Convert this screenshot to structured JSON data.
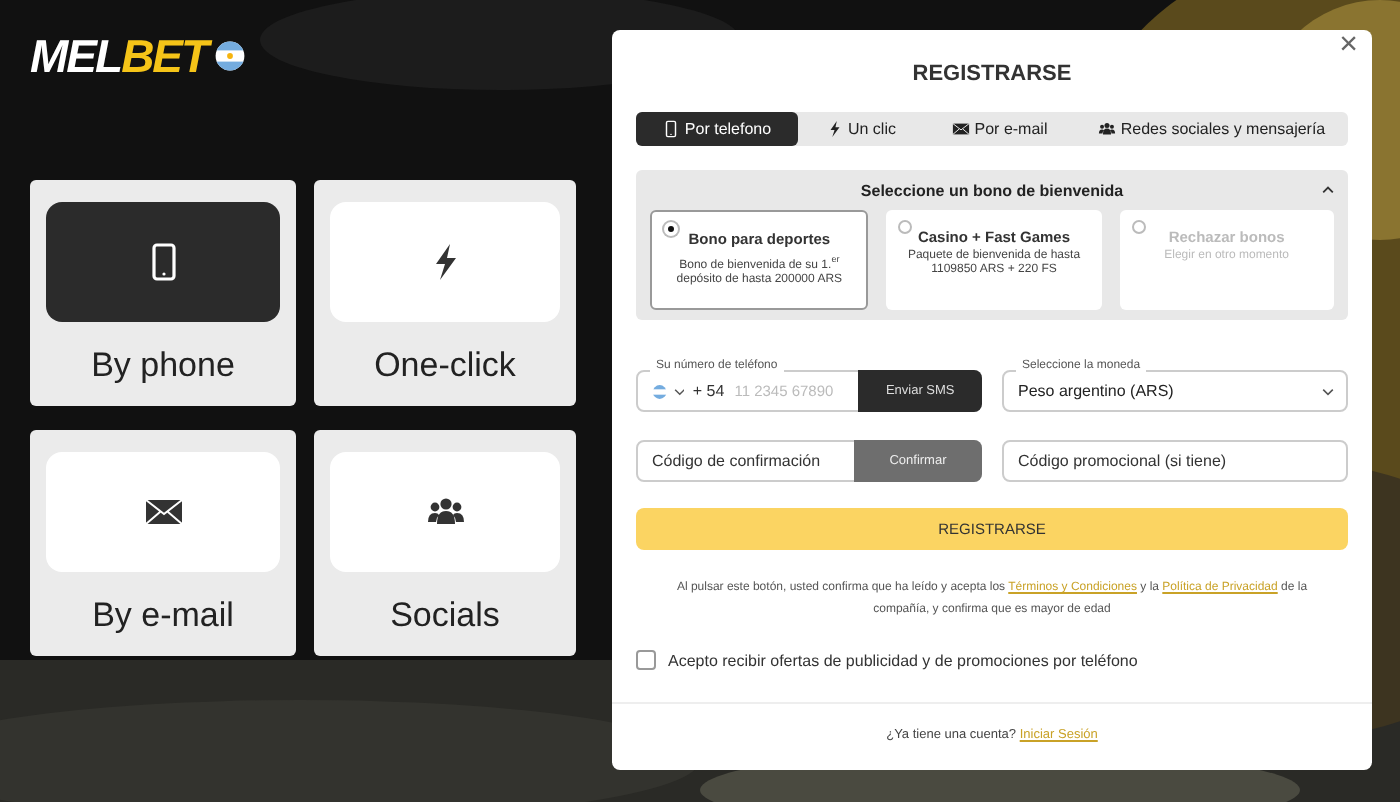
{
  "logo": {
    "first": "MEL",
    "second": "BET"
  },
  "methods": [
    {
      "label": "By phone",
      "kind": "phone",
      "selected": true
    },
    {
      "label": "One-click",
      "kind": "bolt",
      "selected": false
    },
    {
      "label": "By e-mail",
      "kind": "mail",
      "selected": false
    },
    {
      "label": "Socials",
      "kind": "people",
      "selected": false
    }
  ],
  "modal": {
    "close": "×",
    "title": "REGISTRARSE",
    "tabs": [
      {
        "label": "Por telefono",
        "kind": "phone",
        "selected": true
      },
      {
        "label": "Un clic",
        "kind": "bolt",
        "selected": false
      },
      {
        "label": "Por e-mail",
        "kind": "mail",
        "selected": false
      },
      {
        "label": "Redes sociales y mensajería",
        "kind": "people",
        "selected": false
      }
    ],
    "bonus": {
      "title": "Seleccione un bono de bienvenida",
      "expanded": true,
      "options": [
        {
          "title": "Bono para deportes",
          "text": "Bono de bienvenida de su 1.$^{er}$ depósito de hasta 200000 ARS",
          "selected": true,
          "muted": false
        },
        {
          "title": "Casino + Fast Games",
          "text": "Paquete de bienvenida de hasta 1109850 ARS + 220 FS",
          "selected": false,
          "muted": false
        },
        {
          "title": "Rechazar bonos",
          "text": "Elegir en otro momento",
          "selected": false,
          "muted": true
        }
      ]
    },
    "phone": {
      "label": "Su número de teléfono",
      "code": "+ 54",
      "placeholder": "11 2345 67890",
      "button": "Enviar SMS"
    },
    "currency": {
      "label": "Seleccione la moneda",
      "value": "Peso argentino (ARS)"
    },
    "confirm": {
      "placeholder": "Código de confirmación",
      "button": "Confirmar"
    },
    "promo": {
      "placeholder": "Código promocional (si tiene)"
    },
    "submit": "REGISTRARSE",
    "terms": {
      "before": "Al pulsar este botón, usted confirma que ha leído y acepta los",
      "link1": "Términos y Condiciones",
      "middle": "y la",
      "link2": "Política de Privacidad",
      "after": "de la compañía, y confirma que es mayor de edad"
    },
    "consent": {
      "label": "Acepto recibir ofertas de publicidad y de promociones por teléfono",
      "checked": false
    },
    "footer": {
      "text": "¿Ya tiene una cuenta?",
      "link": "Iniciar Sesión"
    }
  }
}
